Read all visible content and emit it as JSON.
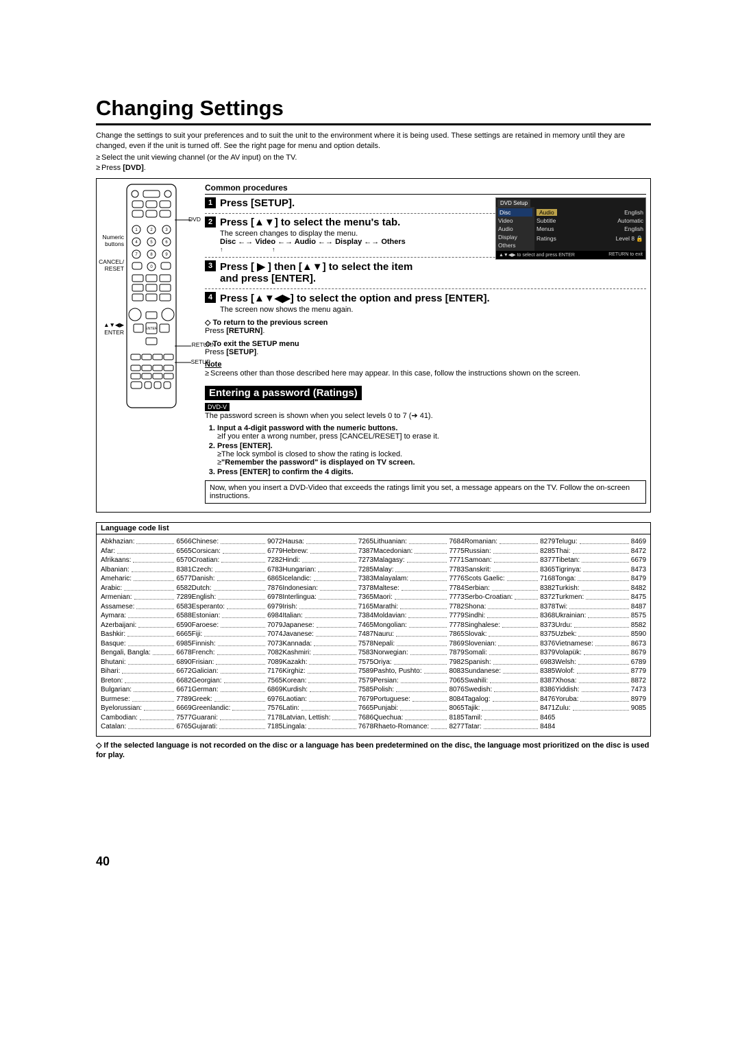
{
  "title": "Changing Settings",
  "intro": "Change the settings to suit your preferences and to suit the unit to the environment where it is being used. These settings are retained in memory until they are changed, even if the unit is turned off. See the right page for menu and option details.",
  "bullets": [
    "Select the unit viewing channel (or the AV input) on the TV.",
    "Press [DVD]."
  ],
  "common_header": "Common procedures",
  "remote_labels": {
    "numeric": "Numeric\nbuttons",
    "cancel": "CANCEL/\nRESET",
    "arrows": "▲▼◀▶\nENTER",
    "dvd_arrow": "DVD",
    "return_arrow": "RETURN",
    "setup_arrow": "SETUP"
  },
  "steps": [
    {
      "n": "1",
      "text": "Press [SETUP]."
    },
    {
      "n": "2",
      "text": "Press [▲▼] to select the menu's tab."
    },
    {
      "n": "3",
      "text": "Press [ ▶ ] then [▲▼] to select the item and press [ENTER]."
    },
    {
      "n": "4",
      "text": "Press [▲▼◀▶]  to select the option and press [ENTER]."
    }
  ],
  "step2_sub": "The screen changes to display the menu.",
  "menu_path": "Disc ←→ Video ←→ Audio ←→ Display ←→ Others",
  "step4_sub": "The screen now shows the menu again.",
  "diamond1_hdr": "To return to the previous screen",
  "diamond1_body": "Press [RETURN].",
  "diamond2_hdr": "To exit the SETUP menu",
  "diamond2_body": "Press [SETUP].",
  "note_hdr": "Note",
  "note_body": "Screens other than those described here may appear. In this case, follow the instructions shown on the screen.",
  "pw_header": "Entering a password (Ratings)",
  "dvd_badge": "DVD-V",
  "pw_intro": "The password screen is shown when you select levels 0 to 7 (➔ 41).",
  "pw_steps": [
    {
      "b": "Input a 4-digit password with the numeric buttons.",
      "subs": [
        "If you enter a wrong number, press [CANCEL/RESET] to erase it."
      ]
    },
    {
      "b": "Press [ENTER].",
      "subs": [
        "The lock symbol is closed to show the rating is locked.",
        "\"Remember the password\" is displayed on TV screen."
      ],
      "subs_strong_idx": 1
    },
    {
      "b": "Press [ENTER] to confirm the 4 digits.",
      "subs": []
    }
  ],
  "pw_box": "Now, when you insert a DVD-Video that exceeds the ratings limit you set, a message appears on the TV. Follow the on-screen instructions.",
  "lang_header": "Language code list",
  "lang_columns": [
    [
      [
        "Abkhazian:",
        "6566"
      ],
      [
        "Afar:",
        "6565"
      ],
      [
        "Afrikaans:",
        "6570"
      ],
      [
        "Albanian:",
        "8381"
      ],
      [
        "Ameharic:",
        "6577"
      ],
      [
        "Arabic:",
        "6582"
      ],
      [
        "Armenian:",
        "7289"
      ],
      [
        "Assamese:",
        "6583"
      ],
      [
        "Aymara:",
        "6588"
      ],
      [
        "Azerbaijani:",
        "6590"
      ],
      [
        "Bashkir:",
        "6665"
      ],
      [
        "Basque:",
        "6985"
      ],
      [
        "Bengali, Bangla:",
        "6678"
      ],
      [
        "Bhutani:",
        "6890"
      ],
      [
        "Bihari:",
        "6672"
      ],
      [
        "Breton:",
        "6682"
      ],
      [
        "Bulgarian:",
        "6671"
      ],
      [
        "Burmese:",
        "7789"
      ],
      [
        "Byelorussian:",
        "6669"
      ],
      [
        "Cambodian:",
        "7577"
      ],
      [
        "Catalan:",
        "6765"
      ]
    ],
    [
      [
        "Chinese:",
        "9072"
      ],
      [
        "Corsican:",
        "6779"
      ],
      [
        "Croatian:",
        "7282"
      ],
      [
        "Czech:",
        "6783"
      ],
      [
        "Danish:",
        "6865"
      ],
      [
        "Dutch:",
        "7876"
      ],
      [
        "English:",
        "6978"
      ],
      [
        "Esperanto:",
        "6979"
      ],
      [
        "Estonian:",
        "6984"
      ],
      [
        "Faroese:",
        "7079"
      ],
      [
        "Fiji:",
        "7074"
      ],
      [
        "Finnish:",
        "7073"
      ],
      [
        "French:",
        "7082"
      ],
      [
        "Frisian:",
        "7089"
      ],
      [
        "Galician:",
        "7176"
      ],
      [
        "Georgian:",
        "7565"
      ],
      [
        "German:",
        "6869"
      ],
      [
        "Greek:",
        "6976"
      ],
      [
        "Greenlandic:",
        "7576"
      ],
      [
        "Guarani:",
        "7178"
      ],
      [
        "Gujarati:",
        "7185"
      ]
    ],
    [
      [
        "Hausa:",
        "7265"
      ],
      [
        "Hebrew:",
        "7387"
      ],
      [
        "Hindi:",
        "7273"
      ],
      [
        "Hungarian:",
        "7285"
      ],
      [
        "Icelandic:",
        "7383"
      ],
      [
        "Indonesian:",
        "7378"
      ],
      [
        "Interlingua:",
        "7365"
      ],
      [
        "Irish:",
        "7165"
      ],
      [
        "Italian:",
        "7384"
      ],
      [
        "Japanese:",
        "7465"
      ],
      [
        "Javanese:",
        "7487"
      ],
      [
        "Kannada:",
        "7578"
      ],
      [
        "Kashmiri:",
        "7583"
      ],
      [
        "Kazakh:",
        "7575"
      ],
      [
        "Kirghiz:",
        "7589"
      ],
      [
        "Korean:",
        "7579"
      ],
      [
        "Kurdish:",
        "7585"
      ],
      [
        "Laotian:",
        "7679"
      ],
      [
        "Latin:",
        "7665"
      ],
      [
        "Latvian, Lettish:",
        "7686"
      ],
      [
        "Lingala:",
        "7678"
      ]
    ],
    [
      [
        "Lithuanian:",
        "7684"
      ],
      [
        "Macedonian:",
        "7775"
      ],
      [
        "Malagasy:",
        "7771"
      ],
      [
        "Malay:",
        "7783"
      ],
      [
        "Malayalam:",
        "7776"
      ],
      [
        "Maltese:",
        "7784"
      ],
      [
        "Maori:",
        "7773"
      ],
      [
        "Marathi:",
        "7782"
      ],
      [
        "Moldavian:",
        "7779"
      ],
      [
        "Mongolian:",
        "7778"
      ],
      [
        "Nauru:",
        "7865"
      ],
      [
        "Nepali:",
        "7869"
      ],
      [
        "Norwegian:",
        "7879"
      ],
      [
        "Oriya:",
        "7982"
      ],
      [
        "Pashto, Pushto:",
        "8083"
      ],
      [
        "Persian:",
        "7065"
      ],
      [
        "Polish:",
        "8076"
      ],
      [
        "Portuguese:",
        "8084"
      ],
      [
        "Punjabi:",
        "8065"
      ],
      [
        "Quechua:",
        "8185"
      ],
      [
        "Rhaeto-Romance:",
        "8277"
      ]
    ],
    [
      [
        "Romanian:",
        "8279"
      ],
      [
        "Russian:",
        "8285"
      ],
      [
        "Samoan:",
        "8377"
      ],
      [
        "Sanskrit:",
        "8365"
      ],
      [
        "Scots Gaelic:",
        "7168"
      ],
      [
        "Serbian:",
        "8382"
      ],
      [
        "Serbo-Croatian:",
        "8372"
      ],
      [
        "Shona:",
        "8378"
      ],
      [
        "Sindhi:",
        "8368"
      ],
      [
        "Singhalese:",
        "8373"
      ],
      [
        "Slovak:",
        "8375"
      ],
      [
        "Slovenian:",
        "8376"
      ],
      [
        "Somali:",
        "8379"
      ],
      [
        "Spanish:",
        "6983"
      ],
      [
        "Sundanese:",
        "8385"
      ],
      [
        "Swahili:",
        "8387"
      ],
      [
        "Swedish:",
        "8386"
      ],
      [
        "Tagalog:",
        "8476"
      ],
      [
        "Tajik:",
        "8471"
      ],
      [
        "Tamil:",
        "8465"
      ],
      [
        "Tatar:",
        "8484"
      ]
    ],
    [
      [
        "Telugu:",
        "8469"
      ],
      [
        "Thai:",
        "8472"
      ],
      [
        "Tibetan:",
        "6679"
      ],
      [
        "Tigrinya:",
        "8473"
      ],
      [
        "Tonga:",
        "8479"
      ],
      [
        "Turkish:",
        "8482"
      ],
      [
        "Turkmen:",
        "8475"
      ],
      [
        "Twi:",
        "8487"
      ],
      [
        "Ukrainian:",
        "8575"
      ],
      [
        "Urdu:",
        "8582"
      ],
      [
        "Uzbek:",
        "8590"
      ],
      [
        "Vietnamese:",
        "8673"
      ],
      [
        "Volapük:",
        "8679"
      ],
      [
        "Welsh:",
        "6789"
      ],
      [
        "Wolof:",
        "8779"
      ],
      [
        "Xhosa:",
        "8872"
      ],
      [
        "Yiddish:",
        "7473"
      ],
      [
        "Yoruba:",
        "8979"
      ],
      [
        "Zulu:",
        "9085"
      ]
    ]
  ],
  "lang_footer": "If the selected language is not recorded on the disc or a language has been predetermined on the disc, the language most prioritized on the disc is used for play.",
  "osd": {
    "title": "DVD Setup",
    "left_items": [
      "Disc",
      "Video",
      "Audio",
      "Display",
      "Others"
    ],
    "left_selected_index": 0,
    "rows": [
      [
        "Audio",
        "English"
      ],
      [
        "Subtitle",
        "Automatic"
      ],
      [
        "Menus",
        "English"
      ],
      [
        "",
        ""
      ],
      [
        "Ratings",
        "Level 8 🔒"
      ]
    ],
    "highlight_row": 0,
    "footer_left": "▲▼◀▶ to select and press ENTER",
    "footer_right": "RETURN to exit"
  },
  "page_number": "40"
}
